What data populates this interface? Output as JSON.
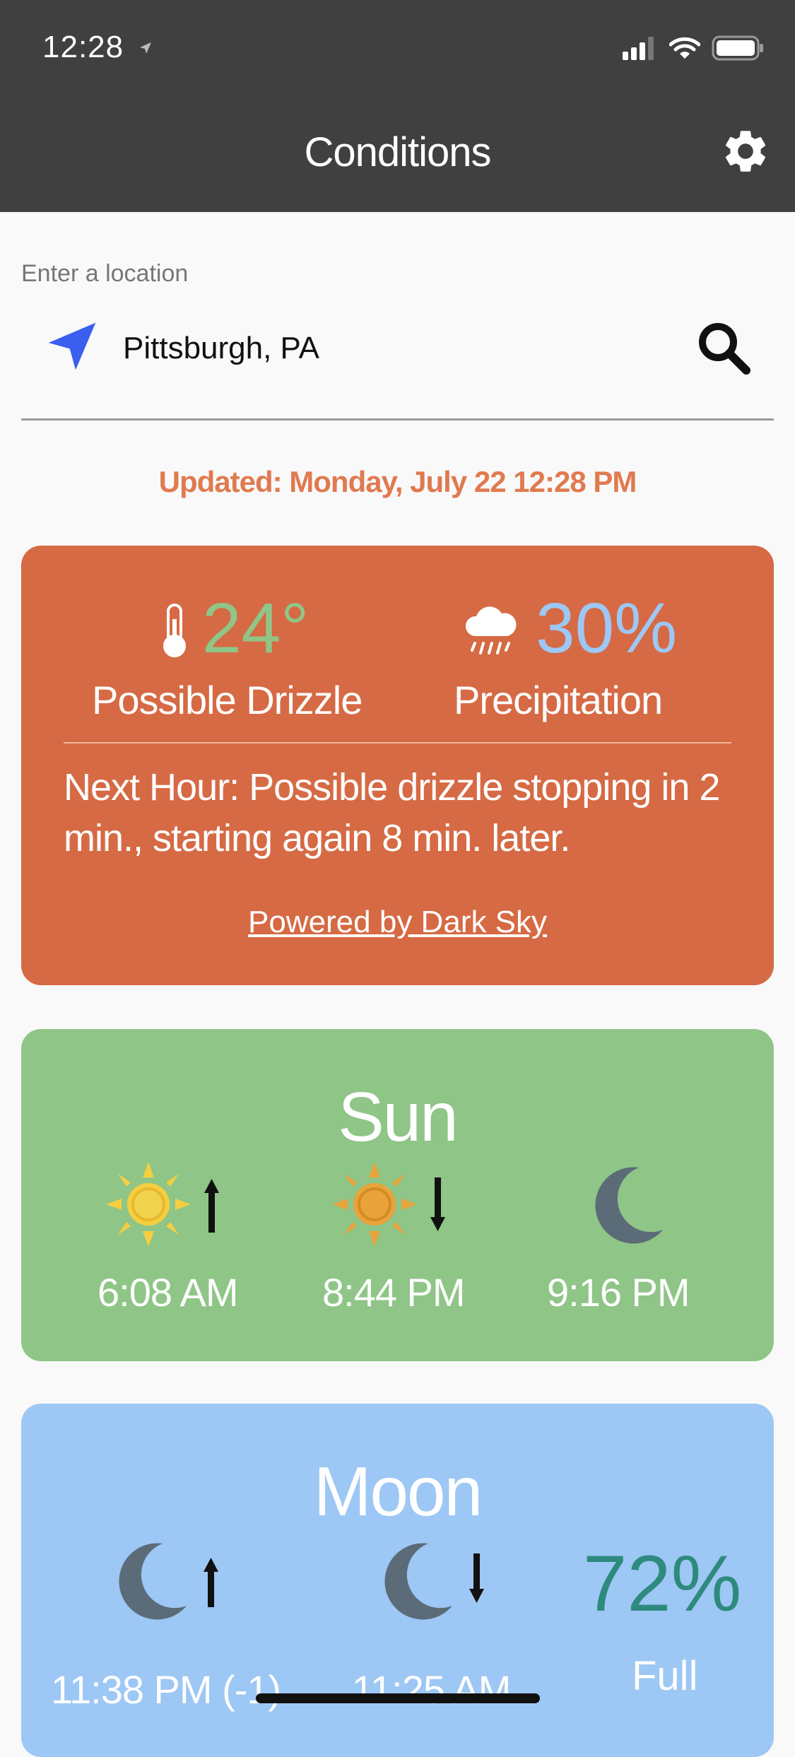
{
  "status_bar": {
    "time": "12:28"
  },
  "header": {
    "title": "Conditions"
  },
  "location": {
    "label": "Enter a location",
    "value": "Pittsburgh, PA"
  },
  "updated": "Updated: Monday, July 22 12:28 PM",
  "conditions": {
    "temperature": "24°",
    "summary": "Possible Drizzle",
    "precip_value": "30%",
    "precip_label": "Precipitation",
    "next_hour": "Next Hour: Possible drizzle stopping in 2 min., starting again 8 min. later.",
    "powered_by": "Powered by Dark Sky"
  },
  "sun": {
    "title": "Sun",
    "sunrise": "6:08 AM",
    "sunset": "8:44 PM",
    "twilight": "9:16 PM"
  },
  "moon": {
    "title": "Moon",
    "moonrise": "11:38 PM (-1)",
    "moonset": "11:25 AM",
    "illumination": "72%",
    "phase_label": "Full"
  },
  "colors": {
    "header": "#404040",
    "accent_orange": "#d66a44",
    "updated_text": "#e07a4f",
    "sun_card": "#8fc587",
    "moon_card": "#9dc7f4",
    "moon_pct": "#2e8a7e",
    "location_arrow": "#3a5ff0"
  }
}
